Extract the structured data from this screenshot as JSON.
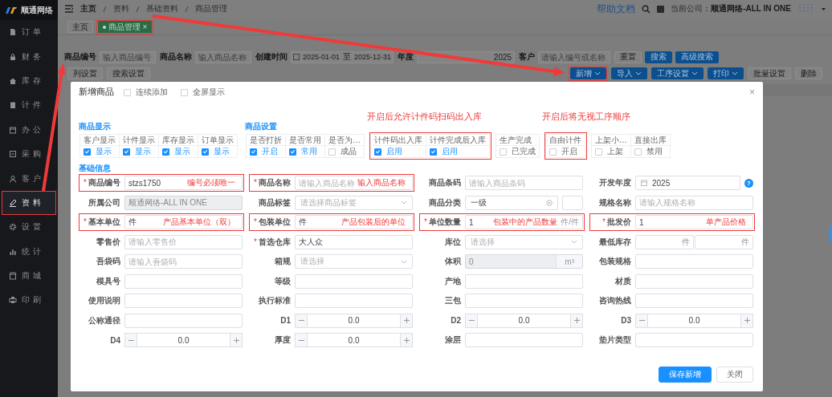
{
  "sidebar": {
    "logo": "顺通网络",
    "items": [
      {
        "label": "订单",
        "selected": false,
        "highlighted": false
      },
      {
        "label": "财务",
        "selected": false,
        "highlighted": false
      },
      {
        "label": "库存",
        "selected": false,
        "highlighted": false
      },
      {
        "label": "计件",
        "selected": false,
        "highlighted": false
      },
      {
        "label": "办公",
        "selected": false,
        "highlighted": false
      },
      {
        "label": "采购",
        "selected": false,
        "highlighted": false
      },
      {
        "label": "客户",
        "selected": false,
        "highlighted": false
      },
      {
        "label": "资料",
        "selected": true,
        "highlighted": true
      },
      {
        "label": "设置",
        "selected": false,
        "highlighted": false
      },
      {
        "label": "统计",
        "selected": false,
        "highlighted": false
      },
      {
        "label": "商城",
        "selected": false,
        "highlighted": false
      },
      {
        "label": "印刷",
        "selected": false,
        "highlighted": false
      }
    ]
  },
  "header": {
    "breadcrumb": [
      "主页",
      "资料",
      "基础资料",
      "商品管理"
    ],
    "help_link": "帮助文档",
    "company_label": "当前公司：",
    "company": "顺通网络-ALL IN ONE"
  },
  "tabs": [
    {
      "label": "主页",
      "selected": false,
      "highlighted": false
    },
    {
      "label": "商品管理",
      "selected": true,
      "highlighted": true,
      "close": "×"
    }
  ],
  "filter": {
    "fields": [
      {
        "kind": "text",
        "label": "商品编号",
        "placeholder": "输入商品编号"
      },
      {
        "kind": "text",
        "label": "商品名称",
        "placeholder": "输入商品名称"
      },
      {
        "kind": "daterange",
        "label": "创建时间",
        "start": "2025-01-01",
        "separator": "至",
        "end": "2025-12-31"
      },
      {
        "kind": "text",
        "label": "年度",
        "value": "2025"
      },
      {
        "kind": "text",
        "label": "客户",
        "placeholder": "请输入编号或名称"
      }
    ],
    "buttons": [
      {
        "label": "重置",
        "kind": "plain",
        "dropdown": false,
        "highlighted": false
      },
      {
        "label": "搜索",
        "kind": "primary",
        "dropdown": false,
        "highlighted": false
      },
      {
        "label": "高级搜索",
        "kind": "primary",
        "dropdown": false,
        "highlighted": false
      }
    ]
  },
  "toolbar": {
    "left": [
      {
        "label": "列设置",
        "kind": "plain",
        "dropdown": false,
        "highlighted": false
      },
      {
        "label": "搜索设置",
        "kind": "plain",
        "dropdown": false,
        "highlighted": false
      }
    ],
    "right": [
      {
        "label": "新增",
        "kind": "primary",
        "dropdown": true,
        "highlighted": true
      },
      {
        "label": "导入",
        "kind": "primary",
        "dropdown": true,
        "highlighted": false
      },
      {
        "label": "工序设置",
        "kind": "primary",
        "dropdown": true,
        "highlighted": false
      },
      {
        "label": "打印",
        "kind": "primary",
        "dropdown": true,
        "highlighted": false
      },
      {
        "label": "批量设置",
        "kind": "plain",
        "dropdown": false,
        "highlighted": false
      },
      {
        "label": "删除",
        "kind": "plain",
        "dropdown": false,
        "highlighted": false
      }
    ]
  },
  "dialog": {
    "title": "新增商品",
    "close": "×",
    "options": [
      {
        "label": "连续添加",
        "checked": false
      },
      {
        "label": "全屏显示",
        "checked": false
      }
    ],
    "switch_groups": [
      {
        "title": "商品显示",
        "segments": [
          {
            "highlighted": false,
            "columns": [
              {
                "header": "客户显示",
                "label": "显示",
                "checked": true
              },
              {
                "header": "计件显示",
                "label": "显示",
                "checked": true
              },
              {
                "header": "库存显示",
                "label": "显示",
                "checked": true
              },
              {
                "header": "订单显示",
                "label": "显示",
                "checked": true
              }
            ]
          }
        ]
      },
      {
        "title": "商品设置",
        "segments": [
          {
            "highlighted": false,
            "columns": [
              {
                "header": "是否打折",
                "label": "开启",
                "checked": true
              },
              {
                "header": "是否常用",
                "label": "常用",
                "checked": true
              },
              {
                "header": "是否为…",
                "label": "成品",
                "checked": false
              }
            ]
          },
          {
            "highlighted": true,
            "annotation": "开启后允许计件码扫码出入库",
            "columns": [
              {
                "header": "计件码出入库",
                "label": "启用",
                "checked": true
              },
              {
                "header": "计件完成后入库",
                "label": "启用",
                "checked": true
              }
            ]
          },
          {
            "highlighted": false,
            "columns": [
              {
                "header": "生产完成",
                "label": "已完成",
                "checked": false
              }
            ]
          },
          {
            "highlighted": true,
            "annotation": "开启后将无视工序顺序",
            "columns": [
              {
                "header": "自由计件",
                "label": "开启",
                "checked": false
              }
            ]
          },
          {
            "highlighted": false,
            "columns": [
              {
                "header": "上架小…",
                "label": "上架",
                "checked": false
              },
              {
                "header": "直接出库",
                "label": "禁用",
                "checked": false
              }
            ]
          }
        ]
      }
    ],
    "form_title": "基础信息",
    "fields": [
      {
        "label": "商品编号",
        "required_mark": "*",
        "kind": "text",
        "value": "stzs1750",
        "highlighted": true,
        "annotation": "编号必须唯一",
        "disabled": false
      },
      {
        "label": "商品名称",
        "required_mark": "*",
        "kind": "text",
        "placeholder": "请输入商品名称",
        "highlighted": true,
        "annotation": "输入商品名称",
        "disabled": false
      },
      {
        "label": "商品条码",
        "kind": "text",
        "placeholder": "请输入商品条码",
        "highlighted": false,
        "disabled": false
      },
      {
        "label": "开发年度",
        "kind": "date",
        "value": "2025",
        "help": "?",
        "highlighted": false,
        "disabled": false
      },
      {
        "label": "所属公司",
        "kind": "text",
        "value": "顺通网络-ALL IN ONE",
        "highlighted": false,
        "disabled": true
      },
      {
        "label": "商品标签",
        "kind": "select",
        "placeholder": "请选择商品标签",
        "highlighted": false,
        "disabled": false
      },
      {
        "label": "商品分类",
        "kind": "category",
        "value": "一级",
        "highlighted": false,
        "disabled": false
      },
      {
        "label": "规格名称",
        "kind": "text",
        "placeholder": "请输入规格名称",
        "highlighted": false,
        "disabled": false
      },
      {
        "label": "基本单位",
        "required_mark": "*",
        "kind": "text",
        "value": "件",
        "highlighted": true,
        "annotation": "产品基本单位（双）",
        "disabled": false
      },
      {
        "label": "包装单位",
        "required_mark": "*",
        "kind": "text",
        "value": "件",
        "highlighted": true,
        "annotation": "产品包装后的单位",
        "disabled": false
      },
      {
        "label": "单位数量",
        "required_mark": "*",
        "kind": "text",
        "value": "1",
        "suffix": "件/件",
        "highlighted": true,
        "annotation": "包装中的产品数量",
        "disabled": false
      },
      {
        "label": "批发价",
        "required_mark": "*",
        "kind": "text",
        "value": "1",
        "highlighted": true,
        "annotation": "单产品价格",
        "disabled": false
      },
      {
        "label": "零售价",
        "kind": "text",
        "placeholder": "请输入零售价",
        "highlighted": false,
        "disabled": false
      },
      {
        "label": "首选仓库",
        "required_mark": "*",
        "kind": "text",
        "value": "大人众",
        "highlighted": false,
        "disabled": false
      },
      {
        "label": "库位",
        "kind": "select",
        "placeholder": "请选择",
        "highlighted": false,
        "disabled": false
      },
      {
        "label": "最低库存",
        "kind": "pair",
        "suffixes": [
          "件",
          "件"
        ],
        "highlighted": false,
        "disabled": false
      },
      {
        "label": "吾袋码",
        "kind": "text",
        "placeholder": "请输入吾袋码",
        "highlighted": false,
        "disabled": false
      },
      {
        "label": "箱规",
        "kind": "select",
        "placeholder": "请选择",
        "highlighted": false,
        "disabled": false
      },
      {
        "label": "体积",
        "kind": "unit",
        "value": "0",
        "unit": "m³",
        "highlighted": false,
        "disabled": true
      },
      {
        "label": "包装规格",
        "kind": "text",
        "highlighted": false,
        "disabled": false
      },
      {
        "label": "模具号",
        "kind": "text",
        "highlighted": false,
        "disabled": false
      },
      {
        "label": "等级",
        "kind": "text",
        "highlighted": false,
        "disabled": false
      },
      {
        "label": "产地",
        "kind": "text",
        "highlighted": false,
        "disabled": false
      },
      {
        "label": "材质",
        "kind": "text",
        "highlighted": false,
        "disabled": false
      },
      {
        "label": "使用说明",
        "kind": "text",
        "highlighted": false,
        "disabled": false
      },
      {
        "label": "执行标准",
        "kind": "text",
        "highlighted": false,
        "disabled": false
      },
      {
        "label": "三包",
        "kind": "text",
        "highlighted": false,
        "disabled": false
      },
      {
        "label": "咨询热线",
        "kind": "text",
        "highlighted": false,
        "disabled": false
      },
      {
        "label": "公称通径",
        "kind": "text",
        "highlighted": false,
        "disabled": false
      },
      {
        "label": "D1",
        "kind": "stepper",
        "value": "0.0",
        "highlighted": false,
        "disabled": false
      },
      {
        "label": "D2",
        "kind": "stepper",
        "value": "0.0",
        "highlighted": false,
        "disabled": false
      },
      {
        "label": "D3",
        "kind": "stepper",
        "value": "0.0",
        "highlighted": false,
        "disabled": false
      },
      {
        "label": "D4",
        "kind": "stepper",
        "value": "0.0",
        "highlighted": false,
        "disabled": false
      },
      {
        "label": "厚度",
        "kind": "stepper",
        "value": "0.0",
        "highlighted": false,
        "disabled": false
      },
      {
        "label": "涂层",
        "kind": "text",
        "highlighted": false,
        "disabled": false
      },
      {
        "label": "垫片类型",
        "kind": "text",
        "highlighted": false,
        "disabled": false
      }
    ],
    "buttons": [
      {
        "label": "保存新增",
        "kind": "primary"
      },
      {
        "label": "关闭",
        "kind": "plain"
      }
    ]
  }
}
